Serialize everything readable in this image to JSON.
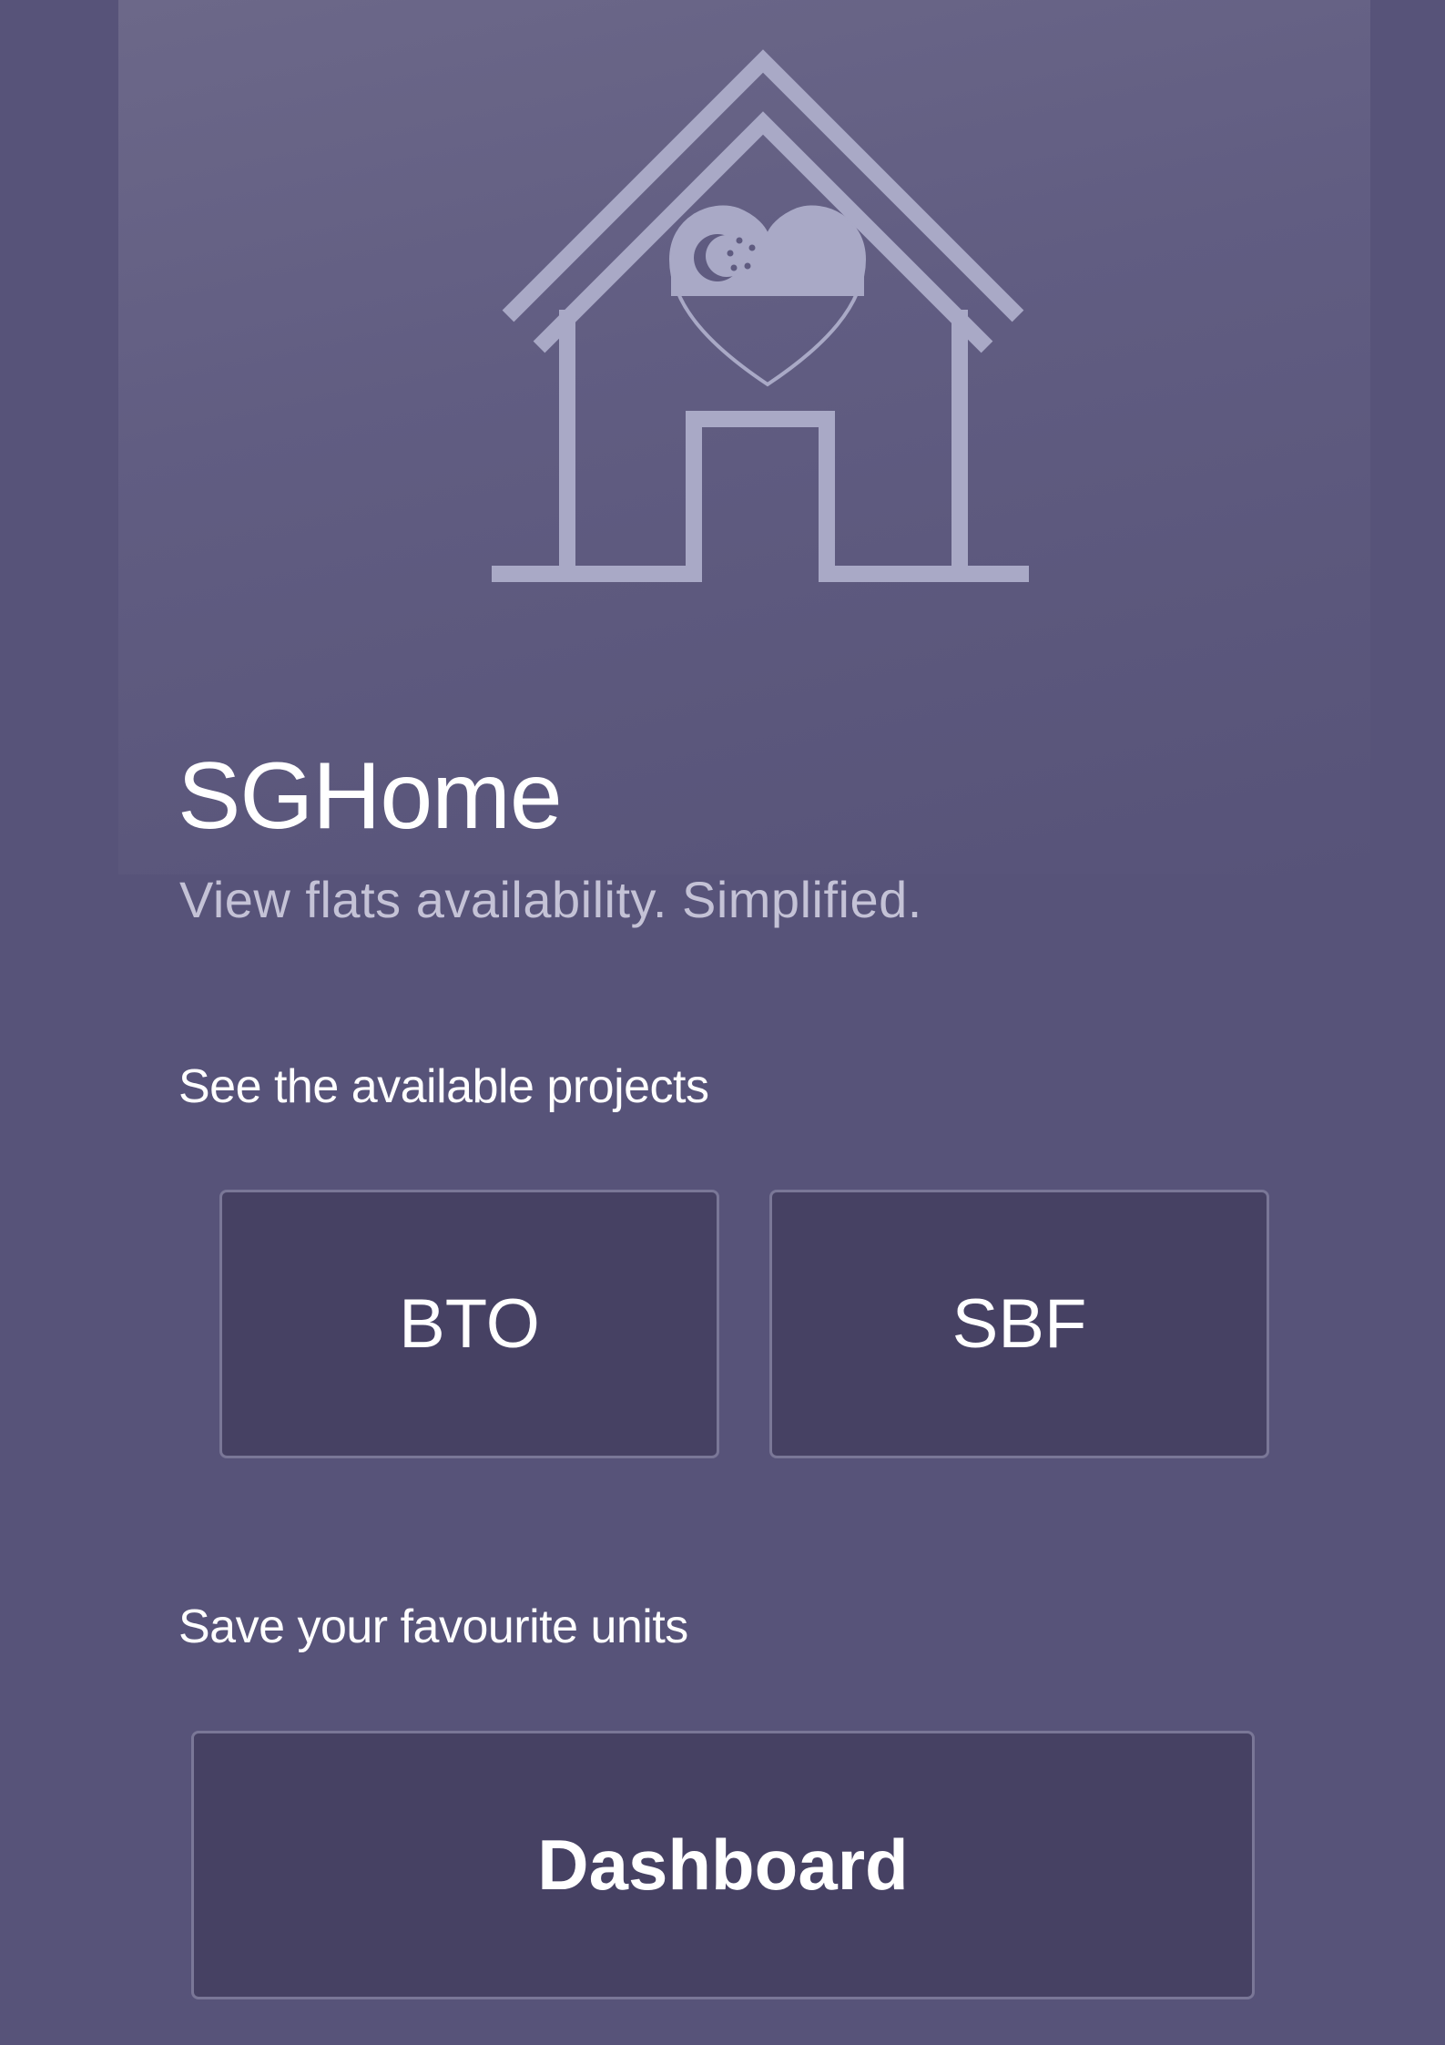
{
  "app": {
    "title": "SGHome",
    "subtitle": "View flats availability. Simplified."
  },
  "logo": {
    "icon": "house-heart-icon",
    "description": "house outline with Singapore flag heart",
    "color": "#a9a9c6"
  },
  "projects_section": {
    "label": "See the available projects",
    "buttons": [
      {
        "label": "BTO"
      },
      {
        "label": "SBF"
      }
    ]
  },
  "favourites_section": {
    "label": "Save your favourite units",
    "button_label": "Dashboard"
  },
  "colors": {
    "background": "#575379",
    "button_fill": "#464163",
    "button_border": "#7a7797",
    "subtitle_text": "#c4c2d6"
  }
}
